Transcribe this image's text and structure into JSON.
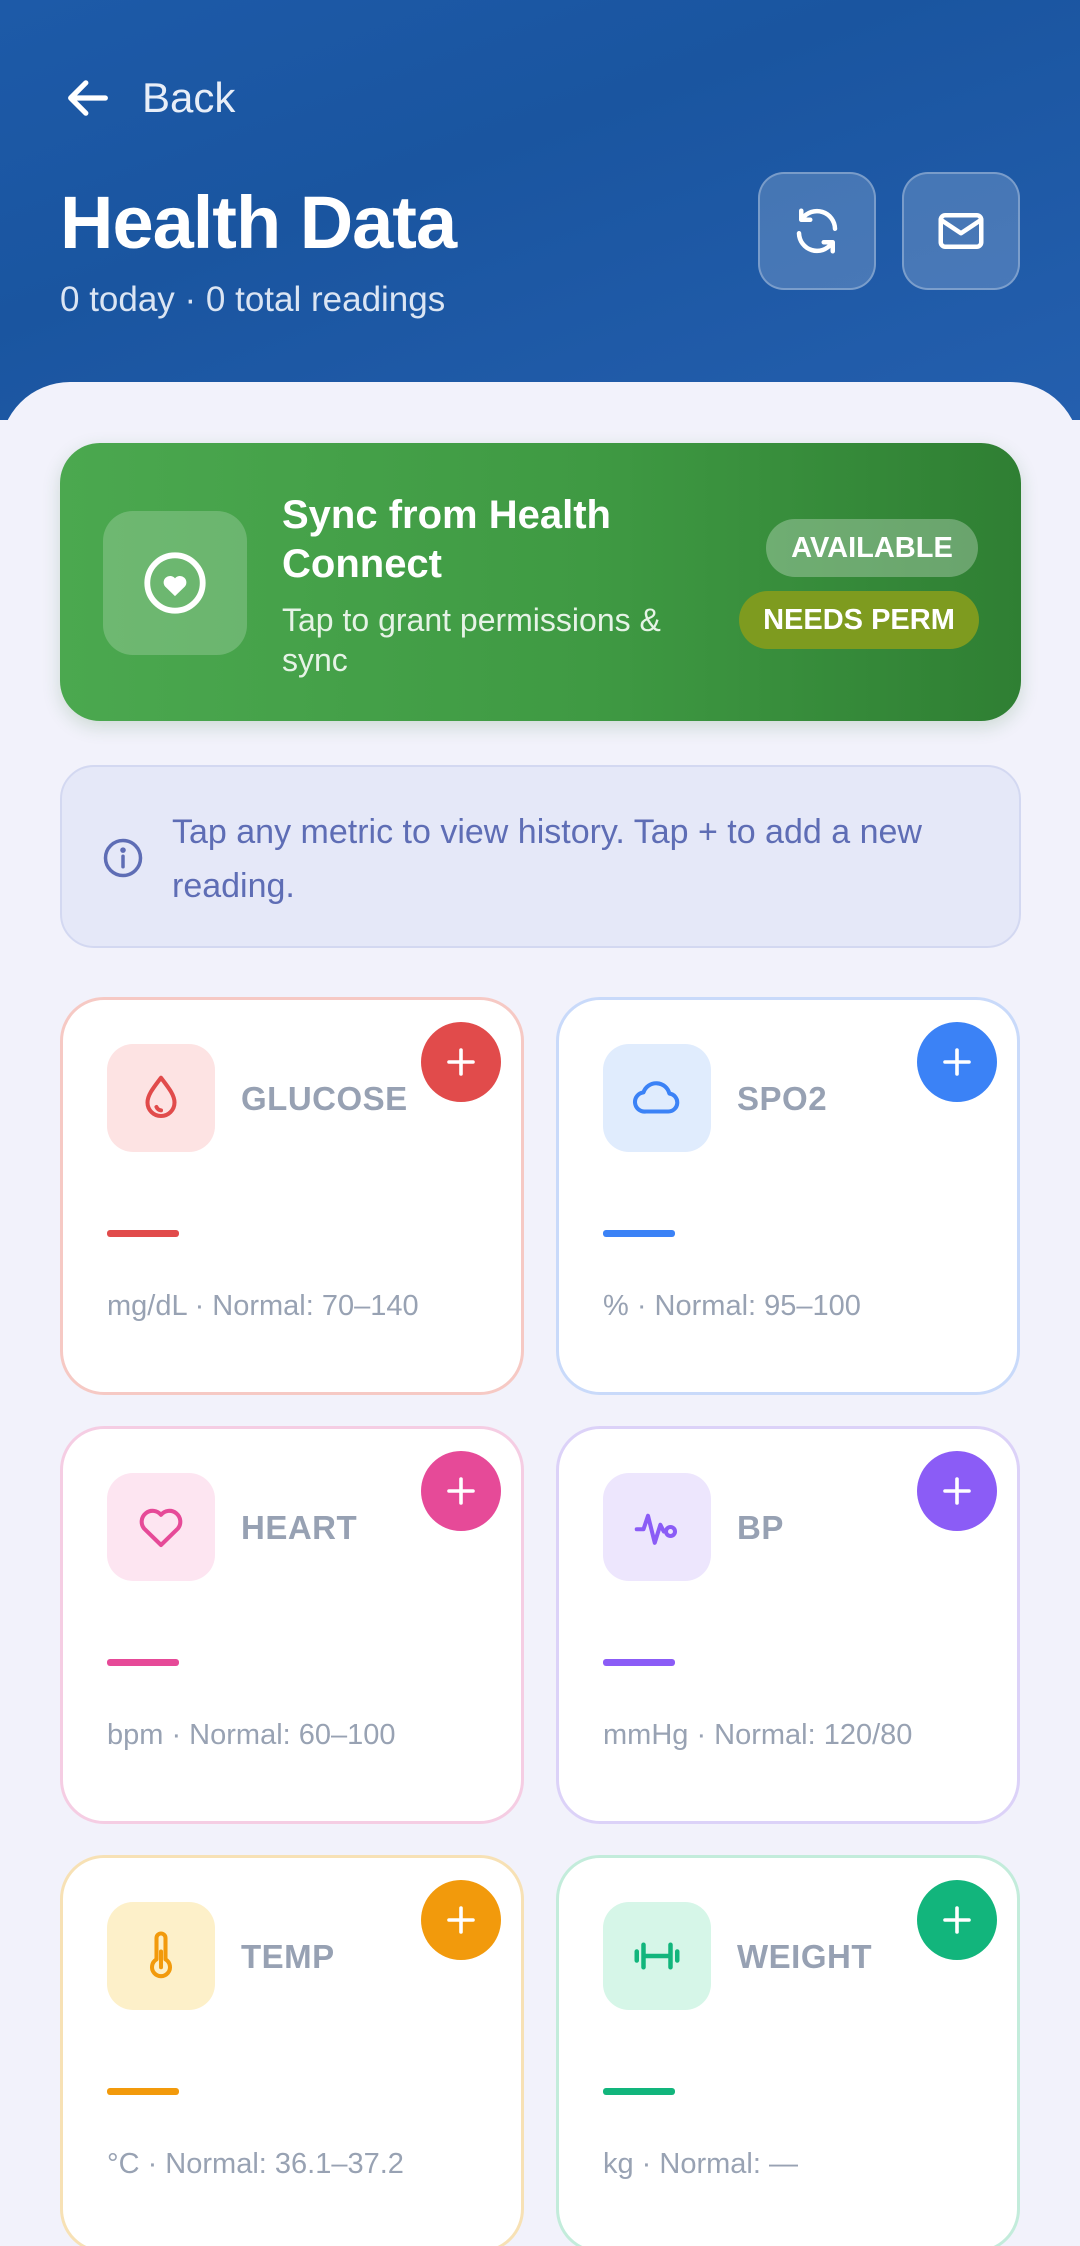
{
  "header": {
    "back_label": "Back",
    "title": "Health Data",
    "subtitle": "0 today · 0 total readings"
  },
  "sync": {
    "title": "Sync from Health Connect",
    "subtitle": "Tap to grant permissions & sync",
    "badge_available": "AVAILABLE",
    "badge_permission": "NEEDS PERM",
    "icon": "heart-circle-icon"
  },
  "info": {
    "text": "Tap any metric to view history. Tap + to add a new reading.",
    "icon": "info-icon"
  },
  "metrics": [
    {
      "name": "GLUCOSE",
      "footer": "mg/dL · Normal: 70–140",
      "icon": "drop-icon",
      "accent": "#e14b4b",
      "tint": "#fde3e3",
      "border": "#f6c9c4"
    },
    {
      "name": "SPO2",
      "footer": "% · Normal: 95–100",
      "icon": "cloud-icon",
      "accent": "#3b82f6",
      "tint": "#e0ecfd",
      "border": "#c9dafa"
    },
    {
      "name": "HEART",
      "footer": "bpm · Normal: 60–100",
      "icon": "heart-icon",
      "accent": "#e64a98",
      "tint": "#fde5f1",
      "border": "#f5cde3"
    },
    {
      "name": "BP",
      "footer": "mmHg · Normal: 120/80",
      "icon": "pulse-icon",
      "accent": "#8b5cf6",
      "tint": "#ede6fd",
      "border": "#dcd2f8"
    },
    {
      "name": "TEMP",
      "footer": "°C · Normal: 36.1–37.2",
      "icon": "thermometer-icon",
      "accent": "#f29a0c",
      "tint": "#fdf0c9",
      "border": "#f7e1b5"
    },
    {
      "name": "WEIGHT",
      "footer": "kg · Normal: —",
      "icon": "dumbbell-icon",
      "accent": "#12b57c",
      "tint": "#d6f6e8",
      "border": "#c3ecdb"
    }
  ],
  "colors": {
    "header_bg": "#1d5aa8",
    "sync_bg": "#3f9a43",
    "page_bg": "#f2f2fb"
  }
}
